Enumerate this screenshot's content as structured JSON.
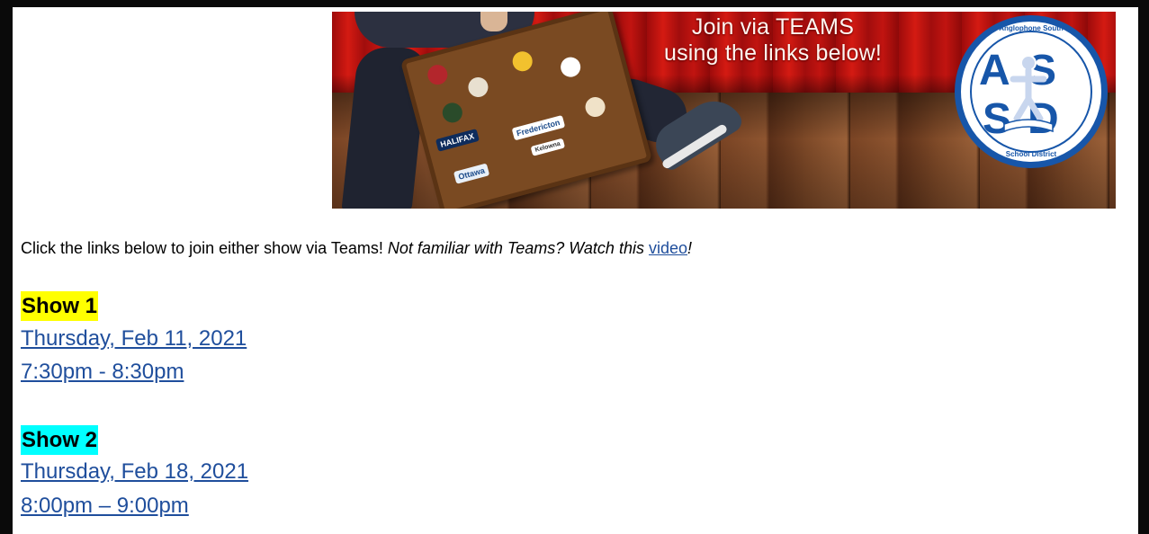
{
  "banner": {
    "line1": "Join via TEAMS",
    "line2": "using the links below!",
    "stickers": [
      "HALIFAX",
      "Fredericton",
      "Ottawa",
      "Kelowna"
    ],
    "logo": {
      "ring_top": "Anglophone South",
      "ring_bottom": "School District",
      "letters": "ASSD"
    }
  },
  "intro": {
    "text": "Click the links below to join either show via Teams! ",
    "italic": "Not familiar with Teams? Watch this ",
    "link": "video",
    "end": "!"
  },
  "shows": [
    {
      "title": "Show 1",
      "date": "Thursday, Feb 11, 2021",
      "time": "7:30pm - 8:30pm"
    },
    {
      "title": "Show 2",
      "date": "Thursday, Feb 18, 2021",
      "time": "8:00pm – 9:00pm"
    }
  ],
  "colors": {
    "show1_highlight": "#ffff00",
    "show2_highlight": "#00ffff",
    "link": "#1f4e9c",
    "logo_blue": "#1756a9"
  }
}
